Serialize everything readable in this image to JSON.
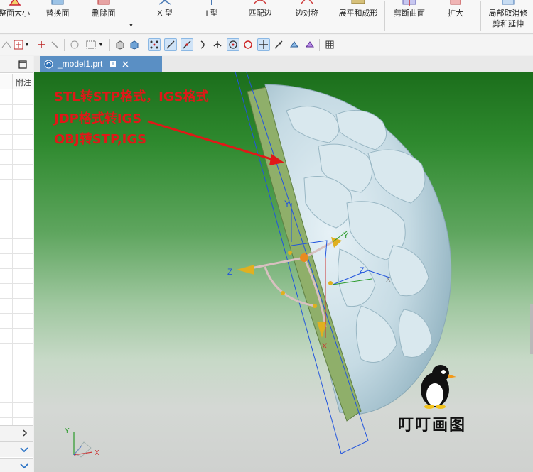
{
  "ribbon": {
    "buttons": [
      {
        "label": "整面大小",
        "icon": "resize-face-icon"
      },
      {
        "label": "替换面",
        "icon": "replace-face-icon"
      },
      {
        "label": "删除面",
        "icon": "delete-face-icon"
      },
      {
        "label": "X 型",
        "icon": "x-form-icon"
      },
      {
        "label": "I 型",
        "icon": "i-form-icon"
      },
      {
        "label": "匹配边",
        "icon": "match-edge-icon"
      },
      {
        "label": "边对称",
        "icon": "edge-symmetry-icon"
      },
      {
        "label": "展平和成形",
        "icon": "flatten-form-icon"
      },
      {
        "label": "剪断曲面",
        "icon": "split-surface-icon"
      },
      {
        "label": "扩大",
        "icon": "enlarge-icon"
      },
      {
        "label_line1": "局部取消修",
        "label_line2": "剪和延伸",
        "icon": "local-untrim-icon"
      }
    ]
  },
  "tab": {
    "label": "_model1.prt"
  },
  "left_panel": {
    "column_header": "附注"
  },
  "viewport": {
    "annotations": [
      "STL转STP格式，IGS格式",
      "JDP格式转IGS",
      "OBJ转STP,IGS"
    ],
    "watermark": "叮叮画图",
    "axes": {
      "x": "X",
      "y": "Y",
      "z": "Z"
    }
  },
  "colors": {
    "annotation": "#e01818",
    "tab_active": "#5a8fc4",
    "background_top": "#1b6e1b",
    "model_face": "#c9dde6",
    "slab": "#8faf6a"
  }
}
